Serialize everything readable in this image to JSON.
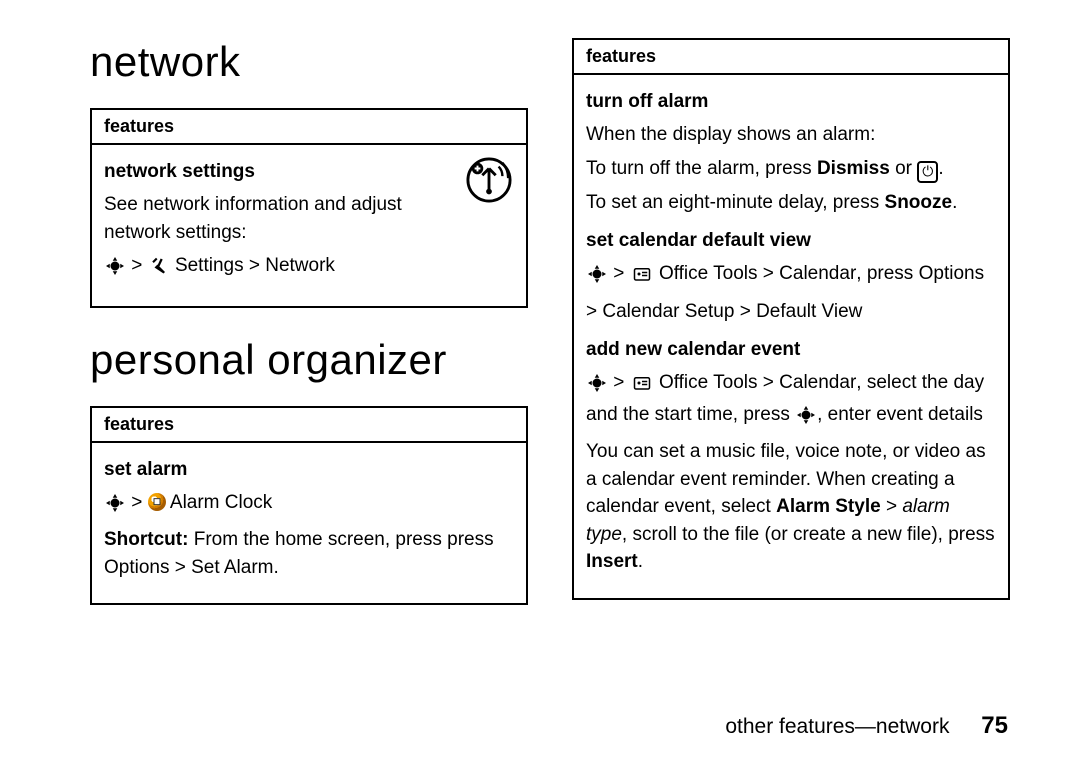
{
  "left": {
    "heading1": "network",
    "box1": {
      "header": "features",
      "sub": "network settings",
      "desc": "See network information and adjust network settings:",
      "path": " Settings > Network",
      "icon_alt": "network-signal-badge"
    },
    "heading2": "personal organizer",
    "box2": {
      "header": "features",
      "sub": "set alarm",
      "alarm_label": " Alarm Clock",
      "shortcut_label": "Shortcut:",
      "shortcut_text": " From the home screen, press press ",
      "shortcut_path": "Options > Set Alarm",
      "period": "."
    }
  },
  "right": {
    "box": {
      "header": "features",
      "turn_off_sub": "turn off alarm",
      "turn_off_line1": "When the display shows an alarm:",
      "turn_off_line2a": "To turn off the alarm, press ",
      "dismiss": "Dismiss",
      "turn_off_line2b": " or ",
      "end_key_alt": "end-call key",
      "end_glyph": "⏻",
      "period": ".",
      "turn_off_line3a": "To set an eight-minute delay, press ",
      "snooze": "Snooze",
      "cal_view_sub": "set calendar default view",
      "cal_view_path1": " Office Tools > Calendar",
      "cal_view_press": ", press ",
      "options": "Options",
      "cal_view_path2": "> Calendar Setup > Default View",
      "add_event_sub": "add new calendar event",
      "add_event_path": " Office Tools > Calendar",
      "add_event_text1": ", select the day and the start time, press ",
      "add_event_text2": ", enter event details",
      "reminder_text1": "You can set a music file, voice note, or video as a calendar event reminder. When creating a calendar event, select ",
      "alarm_style": "Alarm Style",
      "reminder_text2": " > ",
      "alarm_type": "alarm type",
      "reminder_text3": ", scroll to the file (or create a new file), press ",
      "insert": "Insert"
    }
  },
  "footer": {
    "text": "other features—network",
    "page": "75"
  }
}
